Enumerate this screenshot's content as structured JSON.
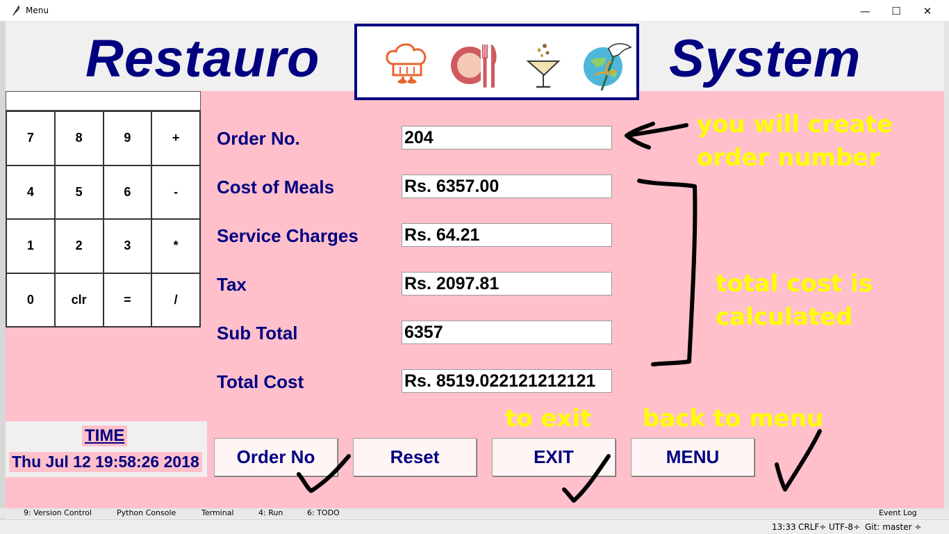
{
  "window": {
    "title": "Menu",
    "minimize_label": "—",
    "maximize_label": "☐",
    "close_label": "✕"
  },
  "banner": {
    "left_title": "Restauro",
    "right_title": "System",
    "logo_icons": [
      "chef-hat-icon",
      "plate-cutlery-icon",
      "cocktail-glass-icon",
      "waiter-globe-icon"
    ]
  },
  "calculator": {
    "display_value": "",
    "keys": [
      "7",
      "8",
      "9",
      "+",
      "4",
      "5",
      "6",
      "-",
      "1",
      "2",
      "3",
      "*",
      "0",
      "clr",
      "=",
      "/"
    ]
  },
  "clock": {
    "label": "TIME",
    "value": "Thu Jul 12 19:58:26 2018"
  },
  "form": {
    "order_no": {
      "label": "Order No.",
      "value": "204"
    },
    "cost_of_meals": {
      "label": "Cost of Meals",
      "value": "Rs. 6357.00"
    },
    "service_charges": {
      "label": "Service Charges",
      "value": "Rs. 64.21"
    },
    "tax": {
      "label": "Tax",
      "value": "Rs. 2097.81"
    },
    "sub_total": {
      "label": "Sub Total",
      "value": "6357"
    },
    "total_cost": {
      "label": "Total Cost",
      "value": "Rs. 8519.022121212121"
    }
  },
  "buttons": {
    "order_no": "Order No",
    "reset": "Reset",
    "exit": "EXIT",
    "menu": "MENU"
  },
  "annotations": {
    "order_number_line1": "you will create",
    "order_number_line2": "order number",
    "total_line1": "total cost is",
    "total_line2": "calculated",
    "exit_note": "to exit",
    "menu_note": "back to menu"
  },
  "ide": {
    "version_control": "9: Version Control",
    "python_console": "Python Console",
    "terminal": "Terminal",
    "run": "4: Run",
    "todo": "6: TODO",
    "event_log": "Event Log",
    "time": "13:33",
    "line_sep": "CRLF÷",
    "encoding": "UTF-8÷",
    "git": "Git: master ÷"
  },
  "colors": {
    "background": "#ffc0cb",
    "brand": "#000080",
    "annotation": "#ffff00",
    "banner": "#f0f0f0"
  }
}
